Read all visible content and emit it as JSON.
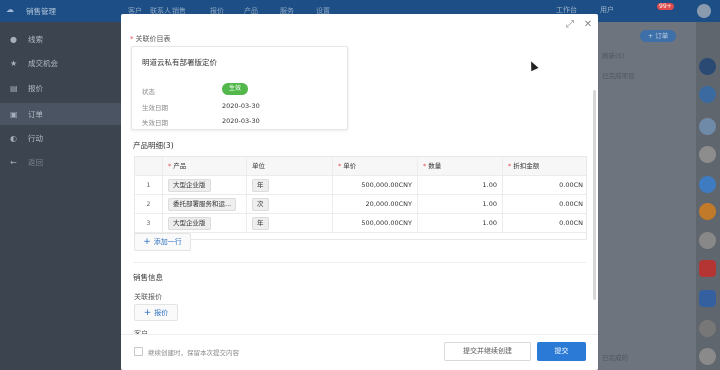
{
  "app": {
    "logo_icon": "cloud-icon",
    "title": "销售管理",
    "nav": [
      "客户",
      "联系人",
      "销售",
      "报价",
      "产品",
      "服务",
      "设置"
    ],
    "top_right": [
      "工作台",
      "用户"
    ],
    "badge_count": "99+"
  },
  "sidebar": {
    "items": [
      {
        "icon": "location-icon",
        "label": "线索"
      },
      {
        "icon": "star-icon",
        "label": "成交机会"
      },
      {
        "icon": "quote-icon",
        "label": "报价"
      },
      {
        "icon": "order-icon",
        "label": "订单"
      },
      {
        "icon": "activity-icon",
        "label": "行动"
      },
      {
        "icon": "back-icon",
        "label": "返回"
      }
    ]
  },
  "background": {
    "new_button": "+ 订单",
    "line1": "刷新(5)",
    "line2": "已完成项目",
    "bottom": "已完成的"
  },
  "modal": {
    "price_list_label": "关联价目表",
    "price_card": {
      "title": "明道云私有部署版定价",
      "status_key": "状态",
      "status_value": "生效",
      "start_key": "生效日期",
      "start_value": "2020-03-30",
      "end_key": "失效日期",
      "end_value": "2020-03-30"
    },
    "products": {
      "title": "产品明细(3)",
      "columns": [
        "",
        "产品",
        "单位",
        "单价",
        "数量",
        "折扣金额"
      ],
      "rows": [
        {
          "idx": "1",
          "product": "大型企业版",
          "unit": "年",
          "price": "500,000.00CNY",
          "qty": "1.00",
          "discount": "0.00CN"
        },
        {
          "idx": "2",
          "product": "委托部署服务和运...",
          "unit": "次",
          "price": "20,000.00CNY",
          "qty": "1.00",
          "discount": "0.00CN"
        },
        {
          "idx": "3",
          "product": "大型企业版",
          "unit": "年",
          "price": "500,000.00CNY",
          "qty": "1.00",
          "discount": "0.00CN"
        }
      ],
      "add_row": "添加一行"
    },
    "sales_info": {
      "title": "销售信息",
      "related_quote_label": "关联报价",
      "add_quote": "报价",
      "cut_off_label": "客户"
    },
    "footer": {
      "keep_label": "继续创建时，保留本次提交内容",
      "submit_continue": "提交并继续创建",
      "submit": "提交"
    }
  }
}
